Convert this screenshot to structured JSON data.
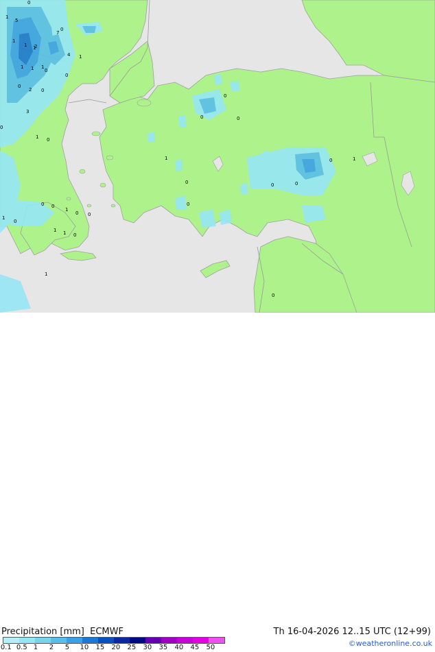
{
  "header": {
    "product": "Precipitation [mm]",
    "model": "ECMWF",
    "valid_time": "Th 16-04-2026 12..15 UTC (12+99)",
    "credit": "©weatheronline.co.uk"
  },
  "legend": {
    "labels": [
      "0.1",
      "0.5",
      "1",
      "2",
      "5",
      "10",
      "15",
      "20",
      "25",
      "30",
      "35",
      "40",
      "45",
      "50"
    ],
    "colors": [
      "#b4f0fa",
      "#96e6f5",
      "#78d2f0",
      "#5abeeb",
      "#3ca0e6",
      "#1e78d2",
      "#0a50be",
      "#0a28a0",
      "#000a80",
      "#6400b4",
      "#a000c8",
      "#c800dc",
      "#e600e6",
      "#f050f0"
    ]
  },
  "map": {
    "land_color": "#adf28a",
    "sea_color": "#e6e6e6",
    "border_color": "#a0a0a0",
    "point_labels": [
      "0",
      "1",
      "5",
      "1",
      "1",
      "1",
      "2",
      "7",
      "4",
      "1",
      "1",
      "1",
      "1",
      "0",
      "0",
      "3",
      "0",
      "2",
      "0",
      "0",
      "1",
      "0",
      "1",
      "0",
      "0",
      "0",
      "0",
      "0",
      "0",
      "0",
      "0",
      "1",
      "0",
      "1",
      "0",
      "0",
      "1",
      "1",
      "0",
      "0",
      "1",
      "1",
      "0",
      "0",
      "0"
    ]
  }
}
